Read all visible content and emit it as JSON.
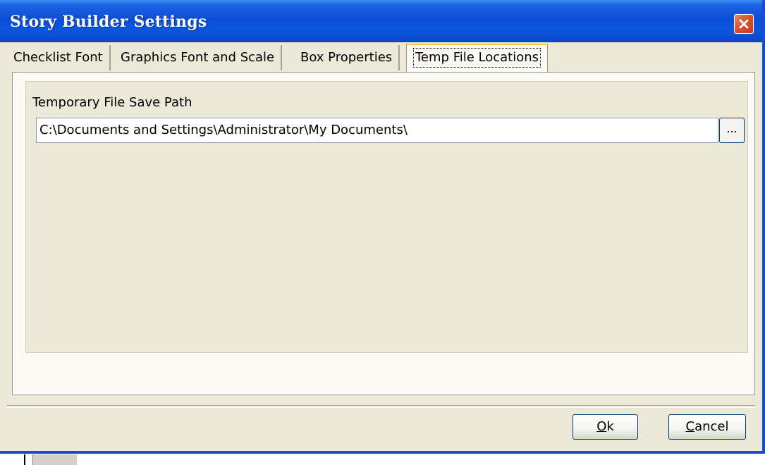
{
  "window": {
    "title": "Story Builder Settings"
  },
  "tabs": [
    {
      "label": "Checklist Font",
      "active": false
    },
    {
      "label": "Graphics Font and Scale",
      "active": false
    },
    {
      "label": "Box Properties",
      "active": false
    },
    {
      "label": "Temp File Locations",
      "active": true
    }
  ],
  "temp_files": {
    "label": "Temporary File Save Path",
    "path_value": "C:\\Documents and Settings\\Administrator\\My Documents\\",
    "browse_label": "..."
  },
  "buttons": {
    "ok": {
      "mnemonic": "O",
      "rest": "k"
    },
    "cancel": {
      "mnemonic": "C",
      "rest": "ancel"
    }
  },
  "icons": {
    "close": "close-icon"
  },
  "colors": {
    "titlebar": "#0a4ed8",
    "close_button": "#d8522c",
    "dialog_face": "#ece9d8",
    "active_tab_highlight": "#ffc83c"
  }
}
